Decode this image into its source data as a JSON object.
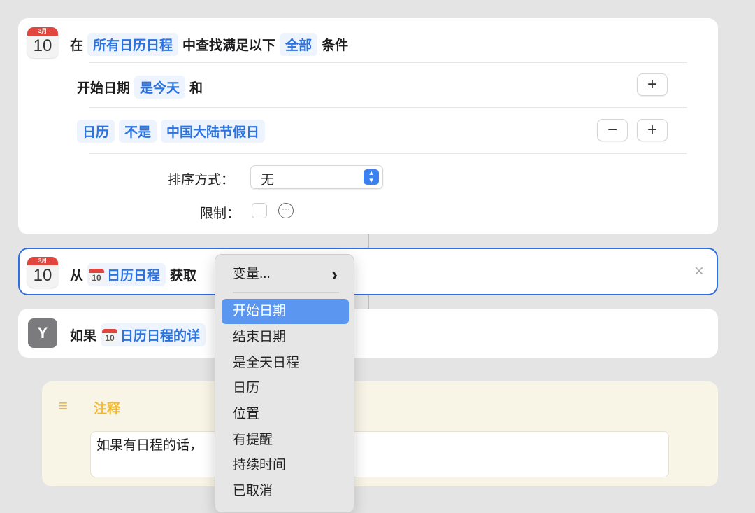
{
  "find_action": {
    "calendar_month": "3月",
    "calendar_day": "10",
    "prefix": "在",
    "source": "所有日历日程",
    "middle": "中查找满足以下",
    "match": "全部",
    "suffix": "条件",
    "filter1": {
      "field": "开始日期",
      "op": "是今天",
      "joiner": "和"
    },
    "filter2": {
      "field": "日历",
      "op": "不是",
      "value": "中国大陆节假日"
    },
    "sort_label": "排序方式：",
    "sort_value": "无",
    "limit_label": "限制：",
    "add": "+",
    "remove": "−"
  },
  "get_action": {
    "prefix": "从",
    "variable": "日历日程",
    "verb": "获取",
    "close": "×"
  },
  "if_action": {
    "prefix": "如果",
    "variable": "日历日程的详"
  },
  "comment": {
    "title": "注释",
    "text": "如果有日程的话，"
  },
  "menu": {
    "variables": "变量...",
    "chevron": "›",
    "items": [
      "开始日期",
      "结束日期",
      "是全天日程",
      "日历",
      "位置",
      "有提醒",
      "持续时间",
      "已取消"
    ],
    "selected": "开始日期"
  }
}
